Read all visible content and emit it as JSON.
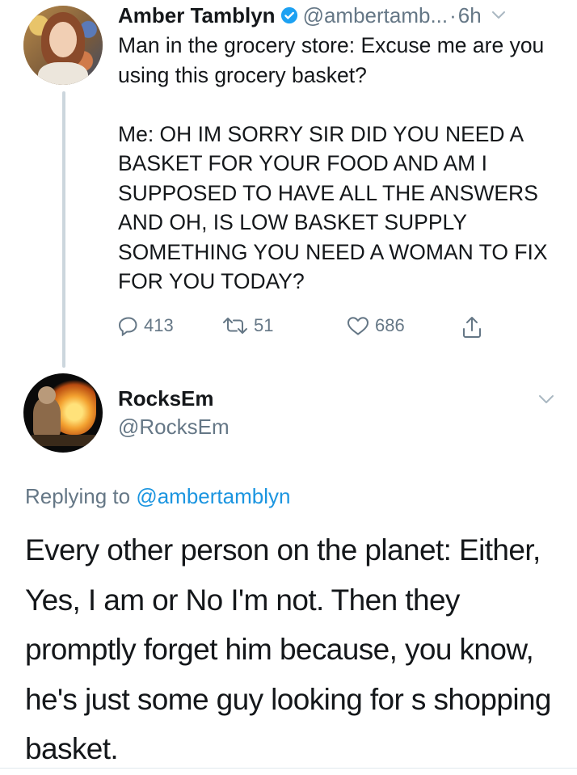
{
  "tweet1": {
    "author_name": "Amber Tamblyn",
    "author_handle": "@ambertamb...",
    "separator": "·",
    "time": "6h",
    "text_para1": "Man in the grocery store: Excuse me are you using this grocery basket?",
    "text_para2": "Me: OH IM SORRY SIR DID YOU NEED A BASKET FOR YOUR FOOD AND AM I SUPPOSED TO HAVE ALL THE ANSWERS AND OH, IS LOW BASKET SUPPLY SOMETHING YOU NEED A WOMAN TO FIX FOR YOU TODAY?",
    "replies": "413",
    "retweets": "51",
    "likes": "686"
  },
  "tweet2": {
    "author_name": "RocksEm",
    "author_handle": "@RocksEm",
    "replying_prefix": "Replying to",
    "replying_handle": "@ambertamblyn",
    "text": "Every other person on the planet: Either,  Yes, I am or No I'm not. Then they promptly forget him because, you know, he's just some guy looking for s shopping basket."
  },
  "icons": {
    "verified": "verified-badge-icon",
    "caret": "chevron-down-icon",
    "reply": "reply-icon",
    "retweet": "retweet-icon",
    "like": "heart-icon",
    "share": "share-icon"
  },
  "colors": {
    "link": "#1b95e0",
    "secondary_text": "#657786",
    "primary_text": "#14171a",
    "thread_line": "#ccd6dd",
    "verified": "#1da1f2"
  }
}
